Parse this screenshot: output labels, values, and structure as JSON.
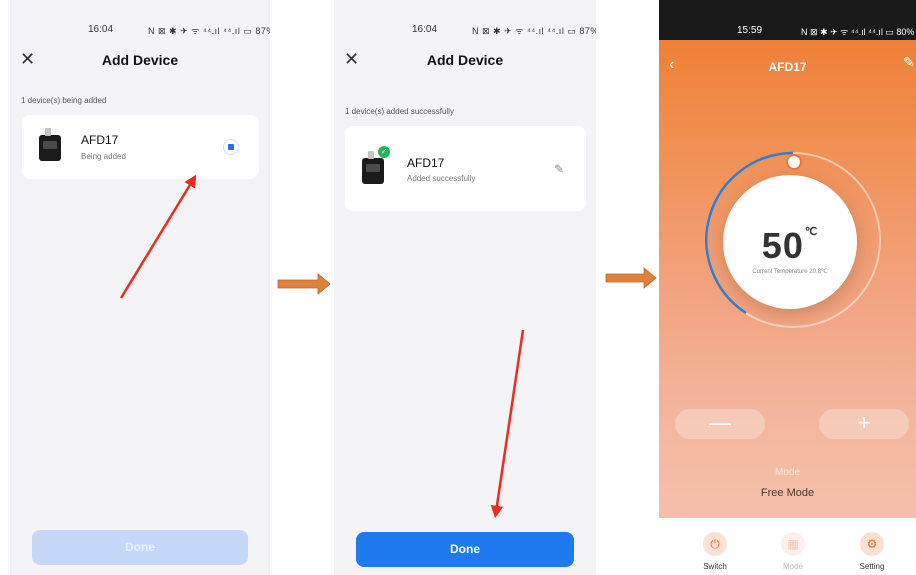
{
  "screen1": {
    "status_time": "16:04",
    "status_icons": "N ⊠ ✱ ✈ ᯤ ⁴⁴.ıl ⁴⁴.ıl ▭ 87%",
    "title": "Add Device",
    "section": "1 device(s) being added",
    "device_name": "AFD17",
    "device_status": "Being added",
    "button_label": "Done"
  },
  "screen2": {
    "status_time": "16:04",
    "status_icons": "N ⊠ ✱ ✈ ᯤ ⁴⁴.ıl ⁴⁴.ıl ▭ 87%",
    "title": "Add Device",
    "section": "1 device(s) added successfully",
    "device_name": "AFD17",
    "device_status": "Added successfully",
    "button_label": "Done"
  },
  "screen3": {
    "status_time": "15:59",
    "status_icons": "N ⊠ ✱ ✈ ᯤ ⁴⁴.ıl ⁴⁴.ıl ▭ 80%",
    "title": "AFD17",
    "temperature": "50",
    "temp_unit": "℃",
    "current_temperature": "Current Temperature 20.8℃",
    "minus": "—",
    "plus": "+",
    "mode_label": "Mode",
    "mode_value": "Free Mode",
    "bottom": {
      "switch": "Switch",
      "mode": "Mode",
      "setting": "Setting"
    }
  },
  "colors": {
    "accent_blue": "#1f7af0",
    "disabled_blue": "#c6d8f8",
    "orange": "#ee7a2e",
    "arrow_red": "#f02a1e",
    "arrow_orange": "#e0803a"
  }
}
